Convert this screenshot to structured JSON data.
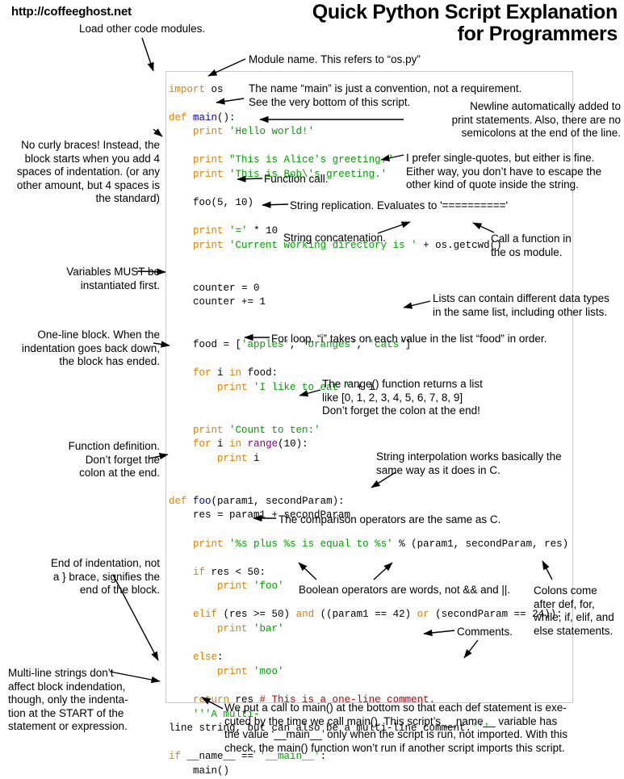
{
  "header": {
    "site_url": "http://coffeeghost.net",
    "title_line1": "Quick Python Script Explanation",
    "title_line2": "for Programmers"
  },
  "code": {
    "language": "python",
    "lines": [
      "import os",
      "",
      "def main():",
      "    print 'Hello world!'",
      "",
      "    print \"This is Alice's greeting.\"",
      "    print 'This is Bob\\'s greeting.'",
      "",
      "    foo(5, 10)",
      "",
      "    print '=' * 10",
      "    print 'Current working directory is ' + os.getcwd()",
      "",
      "",
      "    counter = 0",
      "    counter += 1",
      "",
      "",
      "    food = ['apples', 'oranges', 'cats']",
      "",
      "    for i in food:",
      "        print 'I like to eat ' + i",
      "",
      "",
      "    print 'Count to ten:'",
      "    for i in range(10):",
      "        print i",
      "",
      "",
      "def foo(param1, secondParam):",
      "    res = param1 + secondParam",
      "",
      "    print '%s plus %s is equal to %s' % (param1, secondParam, res)",
      "",
      "    if res < 50:",
      "        print 'foo'",
      "",
      "    elif (res >= 50) and ((param1 == 42) or (secondParam == 24)):",
      "        print 'bar'",
      "",
      "    else:",
      "        print 'moo'",
      "",
      "    return res # This is a one-line comment.",
      "    '''A multi-",
      "line string, but can also be a multi-line comment.'''",
      "",
      "if __name__ == '__main__':",
      "    main()"
    ],
    "colors": {
      "keyword": "#e08000",
      "string": "#00a000",
      "function": "#0000cc",
      "builtin": "#800080",
      "comment": "#c00000",
      "plain": "#000000",
      "panel_border": "#cccccc"
    }
  },
  "annotations": {
    "load_modules": "Load other code modules.",
    "module_name": "Module name. This refers to “os.py”",
    "main_convention": "The name “main” is just a convention, not a requirement.\nSee the very bottom of this script.",
    "newline_print": "Newline automatically added to\nprint statements. Also, there are no\nsemicolons at the end of the line.",
    "no_curly_braces": "No curly braces! Instead, the\nblock starts when you add 4\nspaces of indentation. (or any\nother amount, but 4 spaces is\nthe standard)",
    "single_quotes": "I prefer single-quotes, but either is fine.\nEither way, you don’t have to escape the\nother kind of quote inside the string.",
    "function_call": "Function call.",
    "string_replication": "String replication. Evaluates to '=========='",
    "string_concatenation": "String concatenation.",
    "call_os_function": "Call a function in\nthe os module.",
    "variables_must": "Variables MUST be\ninstantiated first.",
    "lists_data_types": "Lists can contain different data types\nin the same list, including other lists.",
    "one_line_block": "One-line block. When the\nindentation goes back down,\nthe block has ended.",
    "for_loop": "For loop. “i” takes on each value in the list “food” in order.",
    "range_function": "The range() function returns a list\nlike [0, 1, 2, 3, 4, 5, 6, 7, 8, 9]\nDon’t forget the colon at the end!",
    "function_definition": "Function definition.\nDon’t forget the\ncolon at the end.",
    "string_interpolation": "String interpolation works basically the\nsame way as it does in C.",
    "comparison_operators": "The comparison operators are the same as C.",
    "boolean_operators": "Boolean operators are words, not && and ||.",
    "end_of_indentation": "End of indentation, not\na } brace, signifies the\nend of the block.",
    "colons_come_after": "Colons come\nafter def, for,\nwhile, if, elif, and\nelse statements.",
    "comments": "Comments.",
    "multiline_strings": "Multi-line strings don’t\naffect block indendation,\nthough, only the indenta-\ntion at the START of the\nstatement or expression.",
    "main_call": "We put a call to main() at the bottom so that each def statement is exe-\ncuted by the time we call main(). This script’s __name__ variable has\nthe value ‘__main__’ only when the script is run, not imported. With this\ncheck, the main() function won’t run if another script imports this script."
  }
}
